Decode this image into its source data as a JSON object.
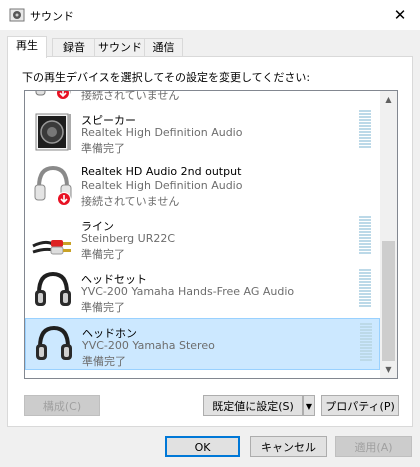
{
  "window": {
    "title": "サウンド",
    "close_glyph": "✕"
  },
  "tabs": [
    {
      "label": "再生",
      "active": true
    },
    {
      "label": "録音",
      "active": false
    },
    {
      "label": "サウンド",
      "active": false
    },
    {
      "label": "通信",
      "active": false
    }
  ],
  "instruction": "下の再生デバイスを選択してその設定を変更してください:",
  "devices": [
    {
      "name": "",
      "desc": "",
      "status": "接続されていません",
      "icon": "headphones-disconnected-icon"
    },
    {
      "name": "スピーカー",
      "desc": "Realtek High Definition Audio",
      "status": "準備完了",
      "icon": "speaker-icon"
    },
    {
      "name": "Realtek HD Audio 2nd output",
      "desc": "Realtek High Definition Audio",
      "status": "接続されていません",
      "icon": "headphones-disconnected-icon"
    },
    {
      "name": "ライン",
      "desc": "Steinberg UR22C",
      "status": "準備完了",
      "icon": "rca-cable-icon"
    },
    {
      "name": "ヘッドセット",
      "desc": "YVC-200 Yamaha Hands-Free AG Audio",
      "status": "準備完了",
      "icon": "headset-icon"
    },
    {
      "name": "ヘッドホン",
      "desc": "YVC-200 Yamaha Stereo",
      "status": "準備完了",
      "icon": "headphones-icon",
      "selected": true
    }
  ],
  "buttons": {
    "configure": "構成(C)",
    "set_default": "既定値に設定(S)",
    "properties": "プロパティ(P)",
    "ok": "OK",
    "cancel": "キャンセル",
    "apply": "適用(A)"
  },
  "colors": {
    "selection": "#cce8ff",
    "selection_border": "#99d1ff",
    "accent": "#0078d7",
    "disconnected": "#e81123"
  }
}
